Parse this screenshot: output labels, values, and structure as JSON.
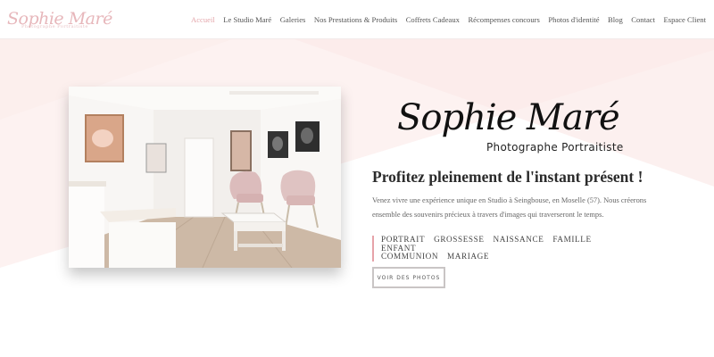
{
  "logo": {
    "name": "Sophie Maré",
    "tagline": "Photographe Portraitiste"
  },
  "nav": [
    {
      "label": "Accueil",
      "active": true
    },
    {
      "label": "Le Studio Maré"
    },
    {
      "label": "Galeries"
    },
    {
      "label": "Nos Prestations & Produits"
    },
    {
      "label": "Coffrets Cadeaux"
    },
    {
      "label": "Récompenses concours"
    },
    {
      "label": "Photos d'identité"
    },
    {
      "label": "Blog"
    },
    {
      "label": "Contact"
    },
    {
      "label": "Espace Client"
    }
  ],
  "hero": {
    "signature": "Sophie Maré",
    "subtitle": "Photographe   Portraitiste",
    "headline": "Profitez pleinement de l'instant présent !",
    "description": "Venez vivre une expérience unique en Studio à Seingbouse, en Moselle (57). Nous créerons ensemble des souvenirs précieux à travers d'images qui traverseront le temps.",
    "tags": [
      "PORTRAIT",
      "GROSSESSE",
      "NAISSANCE",
      "FAMILLE",
      "ENFANT",
      "COMMUNION",
      "MARIAGE"
    ],
    "button_label": "VOIR DES PHOTOS"
  },
  "colors": {
    "accent": "#e4a6ab",
    "background_tint": "#fdf1f0"
  }
}
